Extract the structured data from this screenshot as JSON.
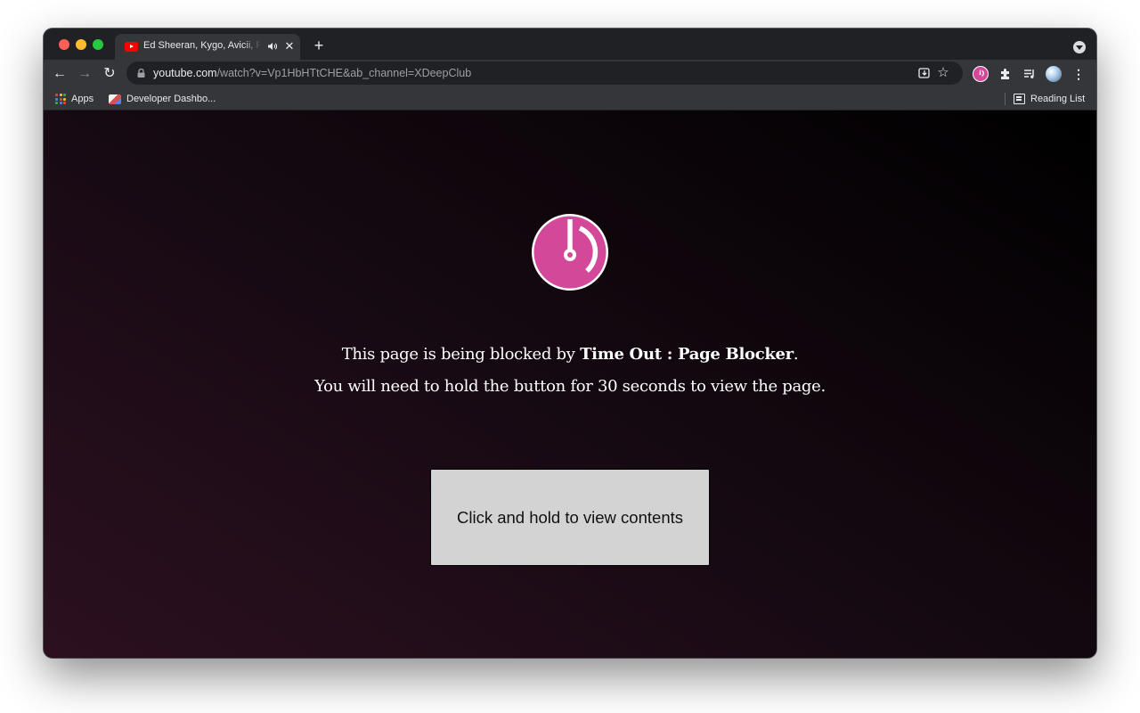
{
  "browser": {
    "tab": {
      "title": "Ed Sheeran, Kygo, Avicii, Robin Schulz",
      "favicon": "youtube-icon",
      "audio_icon": "speaker-icon",
      "close_icon": "close-icon"
    },
    "new_tab_label": "+",
    "url": {
      "host": "youtube.com",
      "path": "/watch?v=Vp1HbHTtCHE&ab_channel=XDeepClub"
    },
    "bookmarks": [
      {
        "label": "Apps",
        "icon": "apps-grid-icon"
      },
      {
        "label": "Developer Dashbo...",
        "icon": "developer-dashboard-icon"
      }
    ],
    "reading_list_label": "Reading List"
  },
  "page": {
    "line1_prefix": "This page is being blocked by ",
    "line1_brand": "Time Out : Page Blocker",
    "line1_suffix": ".",
    "line2": "You will need to hold the button for 30 seconds to view the page.",
    "button_label": "Click and hold to view contents",
    "logo_icon": "timer-icon"
  },
  "colors": {
    "accent": "#d4489a",
    "button_bg": "#d3d3d3",
    "chrome_frame": "#202124",
    "chrome_toolbar": "#35363a"
  }
}
